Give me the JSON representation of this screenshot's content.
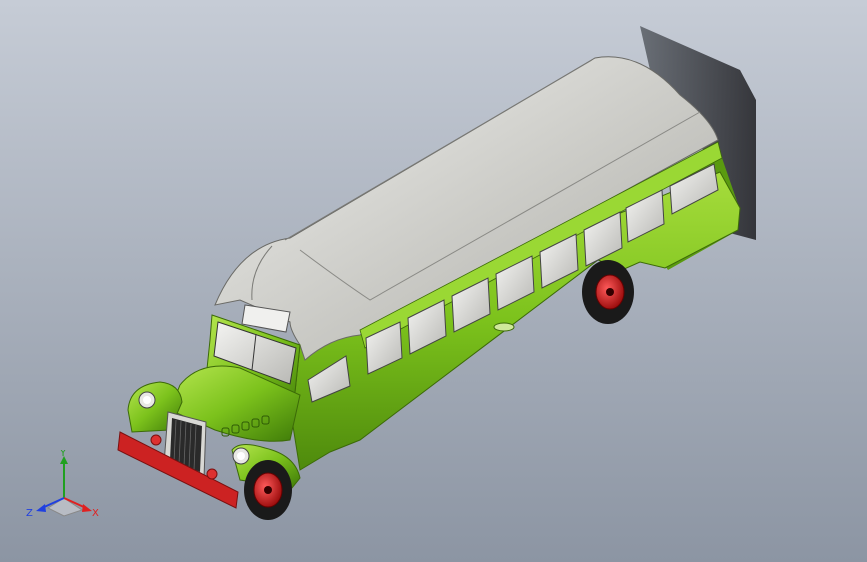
{
  "viewport": {
    "background_top": "#c4cad4",
    "background_bottom": "#8d96a4"
  },
  "model": {
    "body_color": "#7cc21c",
    "roof_color": "#c8c8c4",
    "wheel_rim_color": "#d02828",
    "tire_color": "#1a1a1a",
    "bumper_color": "#cc2222",
    "shadow_color": "#2a2a2a"
  },
  "triad": {
    "x_label": "X",
    "y_label": "Y",
    "z_label": "Z",
    "x_color": "#e02020",
    "y_color": "#20a020",
    "z_color": "#2040e0"
  }
}
